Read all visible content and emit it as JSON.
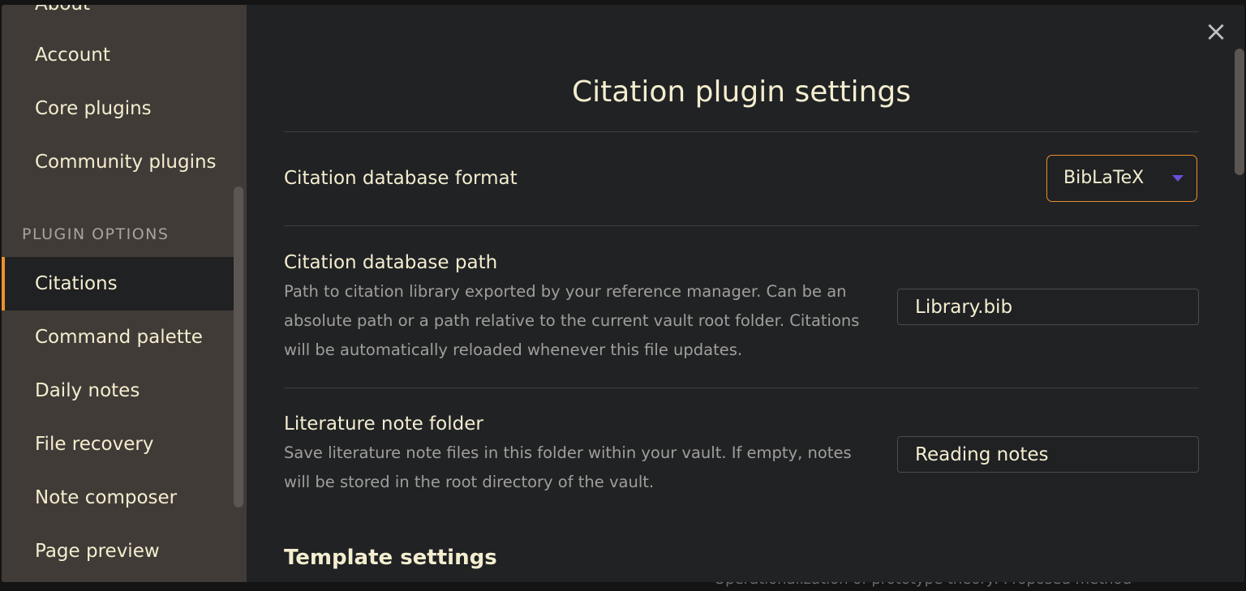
{
  "background": {
    "behind_text": "Operationalization of prototype theory: Proposed method"
  },
  "sidebar": {
    "items_top": [
      "About",
      "Account",
      "Core plugins",
      "Community plugins"
    ],
    "heading": "PLUGIN OPTIONS",
    "items": [
      "Citations",
      "Command palette",
      "Daily notes",
      "File recovery",
      "Note composer",
      "Page preview"
    ],
    "active_item": "Citations"
  },
  "content": {
    "close_icon": "×",
    "title": "Citation plugin settings",
    "settings": {
      "format": {
        "name": "Citation database format",
        "value": "BibLaTeX"
      },
      "path": {
        "name": "Citation database path",
        "desc_lines": [
          "Path to citation library exported by your reference manager. Can be an",
          "absolute path or a path relative to the current vault root folder. Citations",
          "will be automatically reloaded whenever this file updates."
        ],
        "value": "Library.bib"
      },
      "folder": {
        "name": "Literature note folder",
        "desc_lines": [
          "Save literature note files in this folder within your vault. If empty, notes",
          "will be stored in the root directory of the vault."
        ],
        "value": "Reading notes"
      }
    },
    "section_heading": "Template settings"
  },
  "colors": {
    "accent": "#ee8f2a",
    "caret": "#6a4ed6",
    "text": "#f4edcf",
    "muted": "#a09f9b"
  }
}
